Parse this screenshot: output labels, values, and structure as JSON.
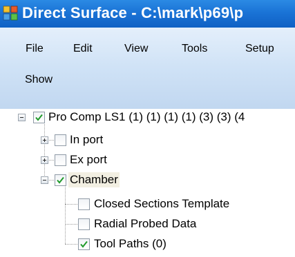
{
  "window": {
    "title": "Direct Surface - C:\\mark\\p69\\p",
    "app_icon": "app-grid-icon"
  },
  "menu": {
    "items": [
      "File",
      "Edit",
      "View",
      "Tools",
      "Setup"
    ],
    "show_label": "Show"
  },
  "tree": {
    "root": {
      "label": "Pro Comp LS1 (1) (1) (1) (1) (3) (3) (4",
      "checked": true,
      "expanded": true
    },
    "nodes": [
      {
        "label": "In port",
        "checked": false,
        "expander": "plus"
      },
      {
        "label": "Ex port",
        "checked": false,
        "expander": "plus"
      },
      {
        "label": "Chamber",
        "checked": true,
        "expander": "minus",
        "selected": true
      }
    ],
    "chamber_children": [
      {
        "label": "Closed Sections Template",
        "checked": false
      },
      {
        "label": "Radial Probed Data",
        "checked": false
      },
      {
        "label": "Tool Paths (0)",
        "checked": true
      }
    ]
  },
  "colors": {
    "title_bar": "#1a73d6",
    "menu_bar": "#cfe2f6",
    "check_mark": "#1f9a2a"
  }
}
